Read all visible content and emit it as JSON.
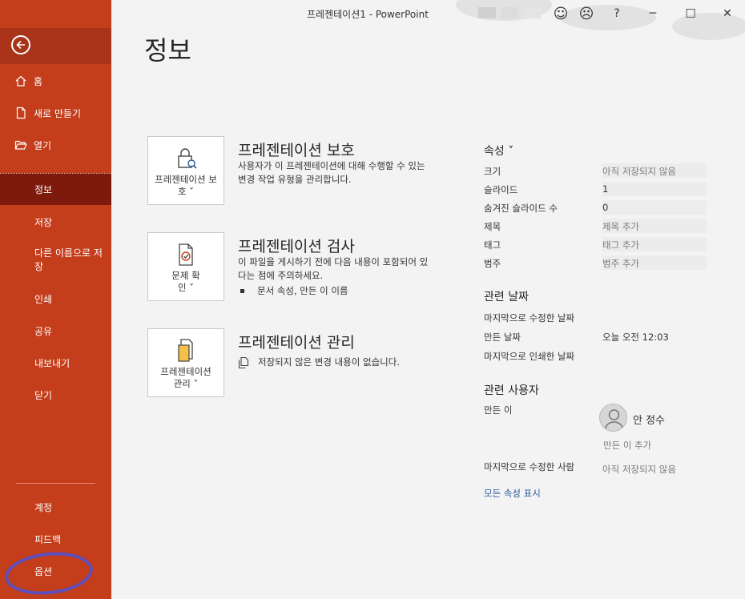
{
  "window": {
    "title": "프레젠테이션1  -  PowerPoint",
    "smile": "☺",
    "frown": "☹",
    "help": "?",
    "minimize": "─",
    "maximize": "☐",
    "close": "✕"
  },
  "sidebar": {
    "home": "홈",
    "new": "새로 만들기",
    "open": "열기",
    "info": "정보",
    "save": "저장",
    "save_as": "다른 이름으로 저장",
    "print": "인쇄",
    "share": "공유",
    "export": "내보내기",
    "close": "닫기",
    "account": "계정",
    "feedback": "피드백",
    "options": "옵션",
    "accent_color": "#c43e1c"
  },
  "main": {
    "page_title": "정보",
    "protect": {
      "tile_label": "프레젠테이션 보호 ˅",
      "title": "프레젠테이션 보호",
      "desc": "사용자가 이 프레젠테이션에 대해 수행할 수 있는 변경 작업 유형을 관리합니다."
    },
    "inspect": {
      "tile_label": "문제 확인 ˅",
      "title": "프레젠테이션 검사",
      "desc": "이 파일을 게시하기 전에 다음 내용이 포함되어 있다는 점에 주의하세요.",
      "bullet": "문서 속성, 만든 이 이름"
    },
    "manage": {
      "tile_label": "프레젠테이션 관리 ˅",
      "title": "프레젠테이션 관리",
      "desc": "저장되지 않은 변경 내용이 없습니다."
    }
  },
  "properties": {
    "heading": "속성 ˅",
    "size_label": "크기",
    "size_value": "아직 저장되지 않음",
    "slides_label": "슬라이드",
    "slides_value": "1",
    "hidden_label": "숨겨진 슬라이드 수",
    "hidden_value": "0",
    "title_label": "제목",
    "title_value": "제목 추가",
    "tags_label": "태그",
    "tags_value": "태그 추가",
    "category_label": "범주",
    "category_value": "범주 추가",
    "dates_heading": "관련 날짜",
    "modified_label": "마지막으로 수정한 날짜",
    "created_label": "만든 날짜",
    "created_value": "오늘 오전 12:03",
    "printed_label": "마지막으로 인쇄한 날짜",
    "people_heading": "관련 사용자",
    "author_label": "만든 이",
    "author_name": "안 정수",
    "add_author": "만든 이 추가",
    "modified_by_label": "마지막으로 수정한 사람",
    "modified_by_value": "아직 저장되지 않음",
    "show_all": "모든 속성 표시",
    "link_color": "#2b579a"
  }
}
